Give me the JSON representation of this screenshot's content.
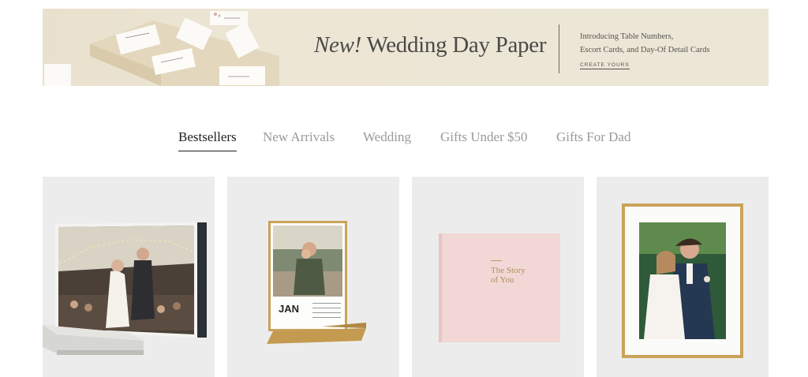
{
  "banner": {
    "headline_em": "New!",
    "headline": "Wedding Day Paper",
    "sub_line1": "Introducing Table Numbers,",
    "sub_line2": "Escort Cards, and Day-Of Detail Cards",
    "cta": "CREATE YOURS"
  },
  "tabs": [
    {
      "label": "Bestsellers",
      "active": true
    },
    {
      "label": "New Arrivals",
      "active": false
    },
    {
      "label": "Wedding",
      "active": false
    },
    {
      "label": "Gifts Under $50",
      "active": false
    },
    {
      "label": "Gifts For Dad",
      "active": false
    }
  ],
  "products": [
    {
      "name": "photo-book"
    },
    {
      "name": "easel-calendar",
      "month": "JAN"
    },
    {
      "name": "linen-book",
      "cover_line1": "The Story",
      "cover_line2": "of You"
    },
    {
      "name": "gold-frame"
    }
  ],
  "colors": {
    "banner_bg": "#ece6d6",
    "card_bg": "#ececec",
    "tab_active": "#1f1f1f",
    "tab_inactive": "#9a9a97"
  }
}
